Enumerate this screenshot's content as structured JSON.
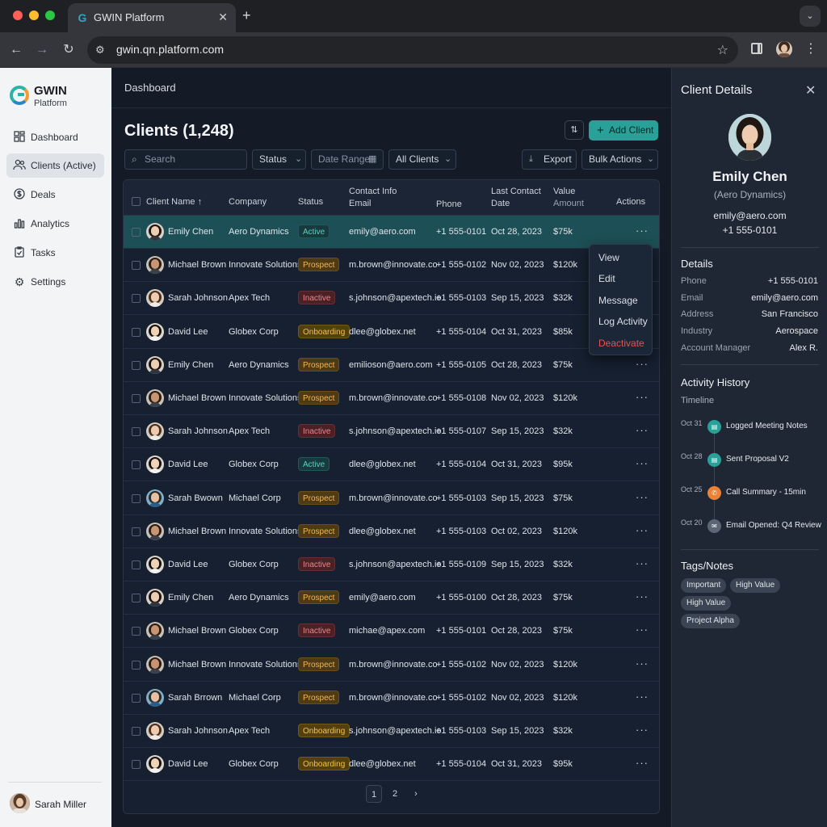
{
  "browser": {
    "tab_title": "GWIN Platform",
    "tab_favicon": "G",
    "url": "gwin.qn.platform.com"
  },
  "app": {
    "brand": "GWIN",
    "brand_sub": "Platform",
    "accent": "#2aa198"
  },
  "sidebar": {
    "items": [
      {
        "label": "Dashboard",
        "icon": "grid-icon"
      },
      {
        "label": "Clients (Active)",
        "icon": "users-icon"
      },
      {
        "label": "Deals",
        "icon": "dollar-icon"
      },
      {
        "label": "Analytics",
        "icon": "bar-chart-icon"
      },
      {
        "label": "Tasks",
        "icon": "checklist-icon"
      },
      {
        "label": "Settings",
        "icon": "gear-icon"
      }
    ],
    "user": "Sarah Miller"
  },
  "main": {
    "breadcrumb": "Dashboard",
    "title": "Clients (1,248)",
    "add_label": "Add Client",
    "search_placeholder": "Search",
    "filters": {
      "status": "Status",
      "date_range": "Date Range",
      "all_clients": "All Clients",
      "export": "Export",
      "bulk": "Bulk Actions"
    },
    "columns": {
      "name": "Client Name",
      "company": "Company",
      "status": "Status",
      "contact_l1": "Contact Info",
      "contact_l2": "Email",
      "phone": "Phone",
      "date_l1": "Last Contact",
      "date_l2": "Date",
      "value_l1": "Value",
      "value_l2": "Amount",
      "actions": "Actions"
    },
    "rows": [
      {
        "name": "Emily Chen",
        "company": "Aero Dynamics",
        "status": "Active",
        "email": "emily@aero.com",
        "phone": "+1 555-0101",
        "date": "Oct 28, 2023",
        "value": "$75k",
        "avatar": "f"
      },
      {
        "name": "Michael Brown",
        "company": "Innovate Solutions",
        "status": "Prospect",
        "email": "m.brown@innovate.co",
        "phone": "+1 555-0102",
        "date": "Nov 02, 2023",
        "value": "$120k",
        "avatar": "m"
      },
      {
        "name": "Sarah Johnson",
        "company": "Apex Tech",
        "status": "Inactive",
        "email": "s.johnson@apextech.io",
        "phone": "+1 555-0103",
        "date": "Sep 15, 2023",
        "value": "$32k",
        "avatar": "f2"
      },
      {
        "name": "David Lee",
        "company": "Globex Corp",
        "status": "Onboarding",
        "email": "dlee@globex.net",
        "phone": "+1 555-0104",
        "date": "Oct 31, 2023",
        "value": "$85k",
        "avatar": "m2"
      },
      {
        "name": "Emily Chen",
        "company": "Aero Dynamics",
        "status": "Prospect",
        "email": "emilioson@aero.com",
        "phone": "+1 555-0105",
        "date": "Oct 28, 2023",
        "value": "$75k",
        "avatar": "f"
      },
      {
        "name": "Michael Brown",
        "company": "Innovate Solutions",
        "status": "Prospect",
        "email": "m.brown@innovate.co",
        "phone": "+1 555-0108",
        "date": "Nov 02, 2023",
        "value": "$120k",
        "avatar": "m"
      },
      {
        "name": "Sarah Johnson",
        "company": "Apex Tech",
        "status": "Inactive",
        "email": "s.johnson@apextech.io",
        "phone": "+1 555-0107",
        "date": "Sep 15, 2023",
        "value": "$32k",
        "avatar": "f2"
      },
      {
        "name": "David Lee",
        "company": "Globex Corp",
        "status": "Active",
        "email": "dlee@globex.net",
        "phone": "+1 555-0104",
        "date": "Oct 31, 2023",
        "value": "$95k",
        "avatar": "m2"
      },
      {
        "name": "Sarah Bwown",
        "company": "Michael Corp",
        "status": "Prospect",
        "email": "m.brown@innovate.co",
        "phone": "+1 555-0103",
        "date": "Sep 15, 2023",
        "value": "$75k",
        "avatar": "m3"
      },
      {
        "name": "Michael Brown",
        "company": "Innovate Solutions",
        "status": "Prospect",
        "email": "dlee@globex.net",
        "phone": "+1 555-0103",
        "date": "Oct 02, 2023",
        "value": "$120k",
        "avatar": "m"
      },
      {
        "name": "David Lee",
        "company": "Globex Corp",
        "status": "Inactive",
        "email": "s.johnson@apextech.io",
        "phone": "+1 555-0109",
        "date": "Sep 15, 2023",
        "value": "$32k",
        "avatar": "m2"
      },
      {
        "name": "Emily Chen",
        "company": "Aero Dynamics",
        "status": "Prospect",
        "email": "emily@aero.com",
        "phone": "+1 555-0100",
        "date": "Oct 28, 2023",
        "value": "$75k",
        "avatar": "f"
      },
      {
        "name": "Michael Brown",
        "company": "Globex Corp",
        "status": "Inactive",
        "email": "michae@apex.com",
        "phone": "+1 555-0101",
        "date": "Oct 28, 2023",
        "value": "$75k",
        "avatar": "m"
      },
      {
        "name": "Michael Brown",
        "company": "Innovate Solutions",
        "status": "Prospect",
        "email": "m.brown@innovate.co",
        "phone": "+1 555-0102",
        "date": "Nov 02, 2023",
        "value": "$120k",
        "avatar": "m"
      },
      {
        "name": "Sarah Brrown",
        "company": "Michael Corp",
        "status": "Prospect",
        "email": "m.brown@innovate.co",
        "phone": "+1 555-0102",
        "date": "Nov 02, 2023",
        "value": "$120k",
        "avatar": "m3"
      },
      {
        "name": "Sarah Johnson",
        "company": "Apex Tech",
        "status": "Onboarding",
        "email": "s.johnson@apextech.io",
        "phone": "+1 555-0103",
        "date": "Sep 15, 2023",
        "value": "$32k",
        "avatar": "f2"
      },
      {
        "name": "David Lee",
        "company": "Globex Corp",
        "status": "Onboarding",
        "email": "dlee@globex.net",
        "phone": "+1 555-0104",
        "date": "Oct 31, 2023",
        "value": "$95k",
        "avatar": "m2"
      }
    ],
    "menu": [
      "View",
      "Edit",
      "Message",
      "Log Activity",
      "Deactivate"
    ],
    "pages": [
      "1",
      "2"
    ]
  },
  "details": {
    "title": "Client Details",
    "name": "Emily Chen",
    "company": "(Aero Dynamics)",
    "email": "emily@aero.com",
    "phone": "+1 555-0101",
    "section_details": "Details",
    "fields": [
      {
        "k": "Phone",
        "v": "+1 555-0101"
      },
      {
        "k": "Email",
        "v": "emily@aero.com"
      },
      {
        "k": "Address",
        "v": "San Francisco"
      },
      {
        "k": "Industry",
        "v": "Aerospace"
      },
      {
        "k": "Account Manager",
        "v": "Alex R."
      }
    ],
    "section_activity": "Activity History",
    "timeline_label": "Timeline",
    "timeline": [
      {
        "date": "Oct 31",
        "text": "Logged Meeting Notes",
        "color": "#2aa198"
      },
      {
        "date": "Oct 28",
        "text": "Sent Proposal V2",
        "color": "#2aa198"
      },
      {
        "date": "Oct 25",
        "text": "Call Summary - 15min",
        "color": "#e8833a"
      },
      {
        "date": "Oct 20",
        "text": "Email Opened: Q4 Review",
        "color": "#5b6675"
      }
    ],
    "section_tags": "Tags/Notes",
    "tags": [
      "Important",
      "High Value",
      "High Value",
      "Project Alpha"
    ]
  }
}
